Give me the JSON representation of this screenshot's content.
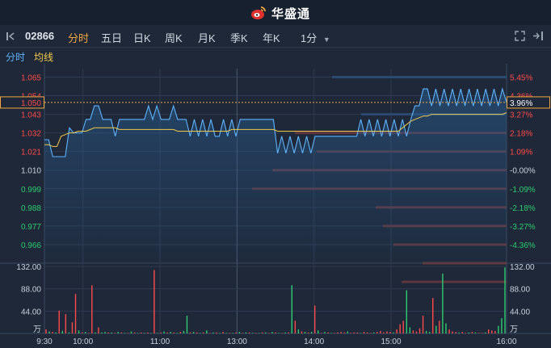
{
  "header": {
    "brand": "华盛通"
  },
  "toolbar": {
    "stock_code": "02866",
    "tabs": [
      "分时",
      "五日",
      "日K",
      "周K",
      "月K",
      "季K",
      "年K"
    ],
    "active_tab": "分时",
    "interval": "1分"
  },
  "subbar": {
    "labels": [
      "分时",
      "均线"
    ]
  },
  "colors": {
    "up": "#ff4a4a",
    "down": "#2ecc71",
    "neutral": "#c9d1dc",
    "price_line": "#5eb4ff",
    "avg_line": "#f2c94c",
    "accent": "#f2a640"
  },
  "chart_data": {
    "type": "line",
    "x_ticks": [
      "9:30",
      "10:00",
      "11:00",
      "13:00",
      "14:00",
      "15:00",
      "16:00"
    ],
    "price_ticks": [
      "1.065",
      "1.054",
      "1.043",
      "1.032",
      "1.021",
      "1.010",
      "0.999",
      "0.988",
      "0.977",
      "0.966"
    ],
    "pct_ticks": [
      "5.45%",
      "4.36%",
      "3.27%",
      "2.18%",
      "1.09%",
      "-0.00%",
      "-1.09%",
      "-2.18%",
      "-3.27%",
      "-4.36%"
    ],
    "current_price": "1.050",
    "current_pct": "3.96%",
    "prev_close": 1.01,
    "ylim": [
      0.955,
      1.07
    ],
    "price": [
      1.028,
      1.028,
      1.018,
      1.018,
      1.018,
      1.018,
      1.035,
      1.032,
      1.032,
      1.032,
      1.04,
      1.04,
      1.048,
      1.048,
      1.04,
      1.04,
      1.04,
      1.03,
      1.04,
      1.04,
      1.04,
      1.04,
      1.04,
      1.04,
      1.04,
      1.048,
      1.04,
      1.048,
      1.04,
      1.04,
      1.04,
      1.048,
      1.04,
      1.04,
      1.04,
      1.03,
      1.04,
      1.03,
      1.04,
      1.03,
      1.04,
      1.03,
      1.03,
      1.04,
      1.03,
      1.04,
      1.03,
      1.04,
      1.04,
      1.04,
      1.04,
      1.04,
      1.04,
      1.04,
      1.04,
      1.04,
      1.02,
      1.03,
      1.02,
      1.03,
      1.02,
      1.03,
      1.02,
      1.03,
      1.02,
      1.03,
      1.03,
      1.03,
      1.03,
      1.03,
      1.03,
      1.03,
      1.03,
      1.03,
      1.03,
      1.03,
      1.04,
      1.03,
      1.04,
      1.03,
      1.04,
      1.03,
      1.04,
      1.03,
      1.04,
      1.03,
      1.04,
      1.03,
      1.04,
      1.048,
      1.048,
      1.058,
      1.058,
      1.048,
      1.058,
      1.048,
      1.058,
      1.048,
      1.058,
      1.048,
      1.058,
      1.048,
      1.058,
      1.048,
      1.058,
      1.048,
      1.058,
      1.048,
      1.058,
      1.048,
      1.058,
      1.05
    ],
    "avg": [
      1.025,
      1.025,
      1.024,
      1.024,
      1.03,
      1.031,
      1.032,
      1.032,
      1.033,
      1.033,
      1.033,
      1.034,
      1.035,
      1.035,
      1.035,
      1.035,
      1.035,
      1.035,
      1.034,
      1.034,
      1.034,
      1.034,
      1.034,
      1.034,
      1.034,
      1.034,
      1.034,
      1.034,
      1.034,
      1.034,
      1.034,
      1.034,
      1.033,
      1.033,
      1.033,
      1.033,
      1.033,
      1.033,
      1.033,
      1.033,
      1.033,
      1.033,
      1.033,
      1.033,
      1.033,
      1.034,
      1.034,
      1.034,
      1.034,
      1.034,
      1.034,
      1.034,
      1.034,
      1.034,
      1.034,
      1.034,
      1.033,
      1.033,
      1.033,
      1.033,
      1.033,
      1.033,
      1.033,
      1.033,
      1.033,
      1.033,
      1.033,
      1.033,
      1.033,
      1.033,
      1.033,
      1.033,
      1.033,
      1.033,
      1.033,
      1.033,
      1.033,
      1.033,
      1.033,
      1.033,
      1.033,
      1.033,
      1.033,
      1.033,
      1.033,
      1.033,
      1.035,
      1.037,
      1.039,
      1.04,
      1.041,
      1.042,
      1.042,
      1.043,
      1.043,
      1.043,
      1.043,
      1.043,
      1.043,
      1.043,
      1.043,
      1.043,
      1.043,
      1.043,
      1.043,
      1.043,
      1.043,
      1.043,
      1.043,
      1.043,
      1.043,
      1.044
    ],
    "vol_ticks": [
      "132.00",
      "88.00",
      "44.00",
      "万"
    ],
    "vol_ylim": [
      0,
      132
    ],
    "volume": [
      8,
      4,
      3,
      2,
      45,
      5,
      38,
      2,
      22,
      78,
      6,
      2,
      3,
      1,
      95,
      2,
      12,
      2,
      3,
      2,
      2,
      1,
      3,
      2,
      1,
      1,
      4,
      2,
      1,
      2,
      1,
      2,
      1,
      125,
      1,
      2,
      4,
      2,
      3,
      2,
      1,
      3,
      5,
      35,
      2,
      3,
      2,
      1,
      2,
      6,
      1,
      2,
      2,
      1,
      3,
      1,
      1,
      1,
      2,
      3,
      1,
      2,
      2,
      1,
      1,
      1,
      2,
      2,
      1,
      3,
      2,
      1,
      1,
      2,
      2,
      95,
      25,
      8,
      4,
      3,
      2,
      3,
      55,
      6,
      1,
      3,
      2,
      1,
      1,
      2,
      3,
      2,
      4,
      1,
      2,
      2,
      1,
      3,
      2,
      1,
      2,
      3,
      5,
      2,
      4,
      3,
      2,
      8,
      18,
      25,
      85,
      12,
      6,
      4,
      10,
      35,
      5,
      3,
      70,
      15,
      25,
      118,
      20,
      8,
      4,
      3,
      2,
      3,
      1,
      2,
      3,
      2,
      1,
      1,
      2,
      8,
      6,
      5,
      15,
      30,
      130
    ],
    "vol_up": [
      1,
      0,
      1,
      0,
      1,
      0,
      1,
      0,
      1,
      1,
      0,
      1,
      0,
      1,
      1,
      0,
      1,
      0,
      0,
      1,
      0,
      1,
      0,
      1,
      0,
      1,
      0,
      1,
      0,
      1,
      0,
      1,
      0,
      1,
      0,
      1,
      0,
      1,
      0,
      1,
      0,
      1,
      0,
      0,
      1,
      0,
      1,
      0,
      1,
      0,
      1,
      0,
      1,
      0,
      1,
      0,
      1,
      0,
      1,
      0,
      1,
      0,
      1,
      0,
      1,
      0,
      1,
      0,
      1,
      0,
      1,
      0,
      1,
      0,
      1,
      0,
      1,
      0,
      1,
      0,
      1,
      0,
      1,
      0,
      1,
      0,
      1,
      0,
      1,
      1,
      1,
      1,
      0,
      1,
      1,
      1,
      0,
      1,
      1,
      1,
      0,
      1,
      1,
      1,
      1,
      1,
      0,
      1,
      1,
      1,
      0,
      0,
      1,
      1,
      1,
      1,
      0,
      0,
      1,
      0,
      1,
      0,
      0,
      1,
      1,
      1,
      0,
      1,
      1,
      0,
      1,
      0,
      1,
      1,
      0,
      1,
      1,
      1,
      0
    ],
    "depth_bars": [
      {
        "price": 1.065,
        "len": 216,
        "type": "ask"
      },
      {
        "price": 1.043,
        "len": 180,
        "type": "ask"
      },
      {
        "price": 1.032,
        "len": 262,
        "type": "bid"
      },
      {
        "price": 1.021,
        "len": 235,
        "type": "bid"
      },
      {
        "price": 1.01,
        "len": 290,
        "type": "bid"
      },
      {
        "price": 0.999,
        "len": 315,
        "type": "bid"
      },
      {
        "price": 0.988,
        "len": 162,
        "type": "bid"
      },
      {
        "price": 0.977,
        "len": 153,
        "type": "bid"
      },
      {
        "price": 0.966,
        "len": 140,
        "type": "bid"
      },
      {
        "price": 0.955,
        "len": 104,
        "type": "bid"
      },
      {
        "price": 0.944,
        "len": 130,
        "type": "bid"
      }
    ]
  }
}
